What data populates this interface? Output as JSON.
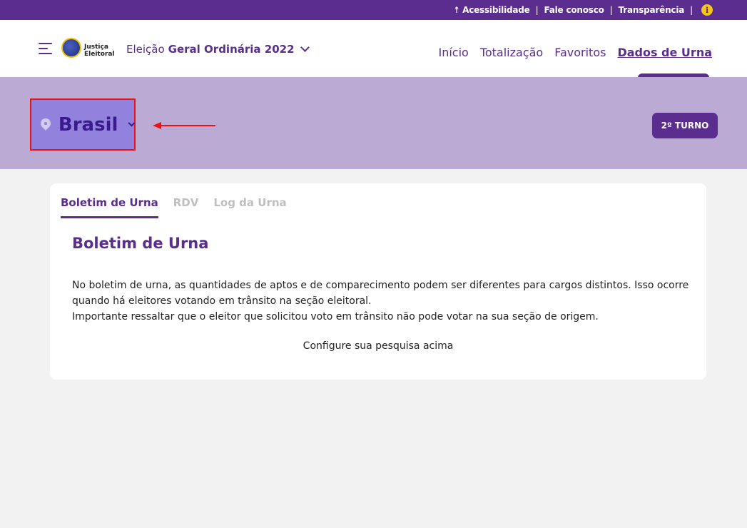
{
  "topbar": {
    "links": [
      "Acessibilidade",
      "Fale conosco",
      "Transparência"
    ],
    "accessibility_glyph": "☨",
    "info_glyph": "i"
  },
  "header": {
    "logo_line1": "Justiça",
    "logo_line2": "Eleitoral",
    "election_prefix": "Eleição",
    "election_name": "Geral Ordinária 2022",
    "nav": [
      "Início",
      "Totalização",
      "Favoritos",
      "Dados de Urna"
    ],
    "active_nav": "Dados de Urna"
  },
  "location": {
    "label": "Brasil",
    "turn_button": "2º TURNO"
  },
  "card": {
    "tabs": [
      "Boletim de Urna",
      "RDV",
      "Log da Urna"
    ],
    "active_tab": "Boletim de Urna",
    "title": "Boletim de Urna",
    "paragraph1": "No boletim de urna, as quantidades de aptos e de comparecimento podem ser diferentes para cargos distintos. Isso ocorre quando há eleitores votando em trânsito na seção eleitoral.",
    "paragraph2": "Importante ressaltar que o eleitor que solicitou voto em trânsito não pode votar na sua seção de origem.",
    "hint": "Configure sua pesquisa acima"
  },
  "colors": {
    "brand": "#5b2d8e",
    "band": "#bbaad3",
    "highlight": "#9282de",
    "annotation": "#ee1111",
    "info_badge": "#f5c518"
  }
}
